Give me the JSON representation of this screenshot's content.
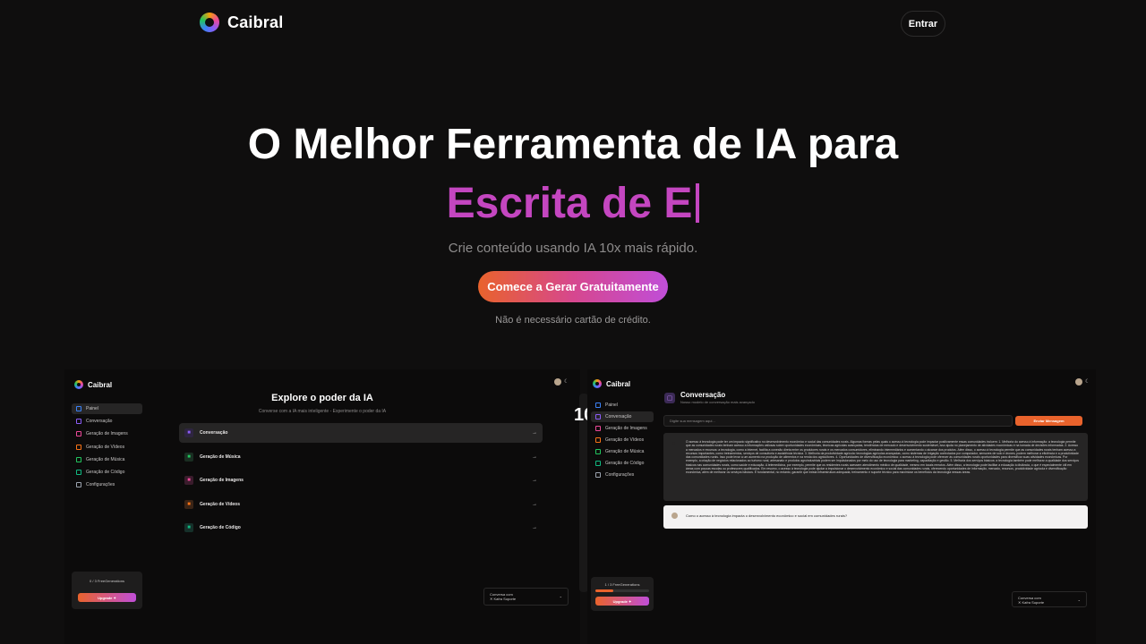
{
  "header": {
    "brand": "Caibral",
    "login_label": "Entrar"
  },
  "hero": {
    "title_line1": "O Melhor Ferramenta de IA para",
    "typed_text": "Escrita de E",
    "subtitle": "Crie conteúdo usando IA 10x mais rápido.",
    "cta_label": "Comece a Gerar Gratuitamente",
    "note": "Não é necessário cartão de crédito."
  },
  "left_preview": {
    "brand": "Caibral",
    "sidebar": [
      {
        "label": "Painel",
        "icon": "dashboard-icon",
        "color": "#3b82f6",
        "active": true
      },
      {
        "label": "Conversação",
        "icon": "chat-icon",
        "color": "#8b5cf6",
        "active": false
      },
      {
        "label": "Geração de Imagens",
        "icon": "image-icon",
        "color": "#ec4899",
        "active": false
      },
      {
        "label": "Geração de Vídeos",
        "icon": "video-icon",
        "color": "#f97316",
        "active": false
      },
      {
        "label": "Geração de Música",
        "icon": "music-icon",
        "color": "#22c55e",
        "active": false
      },
      {
        "label": "Geração de Código",
        "icon": "code-icon",
        "color": "#10b981",
        "active": false
      },
      {
        "label": "Configurações",
        "icon": "gear-icon",
        "color": "#9ca3af",
        "active": false
      }
    ],
    "explore_title": "Explore o poder da IA",
    "explore_subtitle": "Converse com a IA mais inteligente - Experimente o poder da IA",
    "tools": [
      {
        "label": "Conversação",
        "icon": "chat-icon",
        "color": "#8b5cf6",
        "bg": "#2e2540"
      },
      {
        "label": "Geração de Música",
        "icon": "music-icon",
        "color": "#22c55e",
        "bg": "#1a2e22"
      },
      {
        "label": "Geração de Imagens",
        "icon": "image-icon",
        "color": "#ec4899",
        "bg": "#3a1c2c"
      },
      {
        "label": "Geração de Vídeos",
        "icon": "video-icon",
        "color": "#f97316",
        "bg": "#3a2416"
      },
      {
        "label": "Geração de Código",
        "icon": "code-icon",
        "color": "#10b981",
        "bg": "#16302a"
      }
    ],
    "usage": "0 / 3 FreeGenerations",
    "usage_fraction": 0,
    "upgrade_label": "Upgrade ✦",
    "user_line1": "Conversa com",
    "user_line2": "✕ Kafra Suporte"
  },
  "right_preview": {
    "brand": "Caibral",
    "strip_text": "10",
    "sidebar": [
      {
        "label": "Painel",
        "color": "#3b82f6",
        "active": false
      },
      {
        "label": "Conversação",
        "color": "#8b5cf6",
        "active": true
      },
      {
        "label": "Geração de Imagens",
        "color": "#ec4899",
        "active": false
      },
      {
        "label": "Geração de Vídeos",
        "color": "#f97316",
        "active": false
      },
      {
        "label": "Geração de Música",
        "color": "#22c55e",
        "active": false
      },
      {
        "label": "Geração de Código",
        "color": "#10b981",
        "active": false
      },
      {
        "label": "Configurações",
        "color": "#9ca3af",
        "active": false
      }
    ],
    "conv_title": "Conversação",
    "conv_subtitle": "Nosso modelo de conversação mais avançado",
    "input_placeholder": "Digite sua mensagem aqui...",
    "send_label": "Enviar Mensagem",
    "answer": "O acesso à tecnologia pode ter um impacto significativo no desenvolvimento econômico e social das comunidades rurais. Algumas formas pelas quais o acesso à tecnologia pode impactar positivamente essas comunidades incluem: 1. Melhoria do acesso à informação: a tecnologia permite que as comunidades rurais tenham acesso a informações valiosas sobre oportunidades econômicas, técnicas agrícolas avançadas, tendências de mercado e desenvolvimento sustentável, isso ajuda no planejamento de atividades econômicas e na tomada de decisões informadas. 2. Acesso a mercados e recursos: a tecnologia, como a Internet, facilita a conexão direta entre os produtores rurais e os mercados consumidores, eliminando intermediários e aumentando o alcance dos produtos. Além disso, o acesso à tecnologia permite que as comunidades rurais tenham acesso a recursos importantes, como treinamentos, serviços de consultoria e assistência técnica. 3. Melhoria da produtividade agrícola: tecnologias agrícolas avançadas, como sistemas de irrigação controlados por computador, sensores de solo e drones, podem melhorar a eficiência e a produtividade das comunidades rurais. Isso pode levar a um aumento na produção de alimentos e na renda dos agricultores. 4. Oportunidades de diversificação econômica: o acesso à tecnologia pode oferecer às comunidades rurais oportunidades para diversificar suas atividades econômicas. Por exemplo, a criação de negócios relacionados ao turismo rural, artesanato e produtos agroindustriais podem ser impulsionados por meio do uso de tecnologia para marketing, capacitação e gestão. 5. Melhoria dos serviços básicos: a tecnologia também pode melhorar a qualidade dos serviços básicos nas comunidades rurais, como saúde e educação. A telemedicina, por exemplo, permite que os residentes rurais acessem atendimento médico de qualidade, mesmo em locais remotos. Além disso, a tecnologia pode facilitar a educação à distância, o que é especialmente útil em áreas com poucas escolas ou professores qualificados. Em resumo, o acesso à tecnologia pode ajudar a impulsionar o desenvolvimento econômico e social das comunidades rurais, oferecendo oportunidades de informação, mercado, recursos, produtividade agrícola e diversificação econômica, além de melhorar os serviços básicos. É fundamental, no entanto, garantir que exista infraestrutura adequada, treinamento e suporte técnico para maximizar os benefícios da tecnologia nessas áreas.",
    "question": "Como o acesso à tecnologia impacta o desenvolvimento econômico e social em comunidades rurais?",
    "usage": "1 / 3 FreeGenerations",
    "usage_fraction": 0.33,
    "upgrade_label": "Upgrade ✦",
    "user_line1": "Conversa com",
    "user_line2": "✕ Kafra Suporte"
  }
}
